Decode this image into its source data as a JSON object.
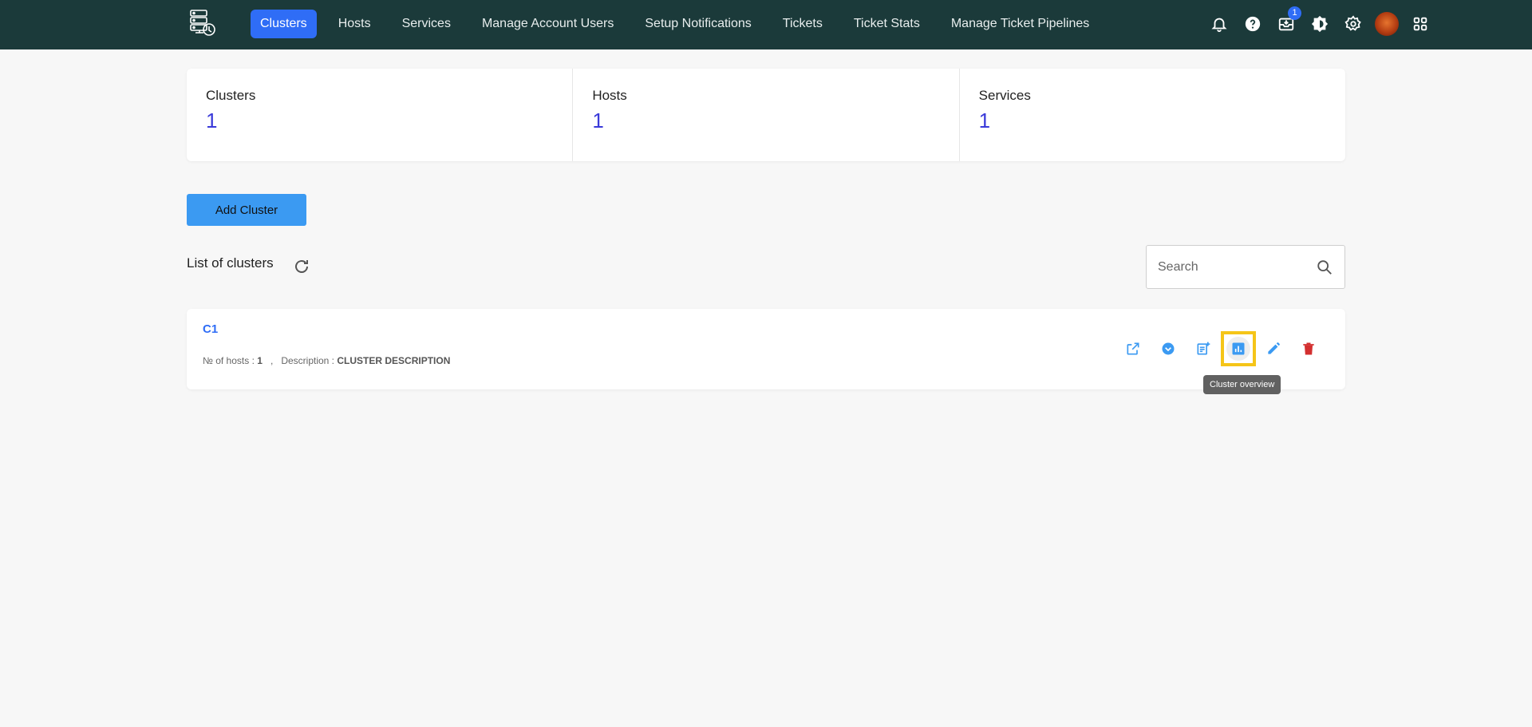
{
  "nav": {
    "items": [
      {
        "label": "Clusters",
        "active": true
      },
      {
        "label": "Hosts",
        "active": false
      },
      {
        "label": "Services",
        "active": false
      },
      {
        "label": "Manage Account Users",
        "active": false
      },
      {
        "label": "Setup Notifications",
        "active": false
      },
      {
        "label": "Tickets",
        "active": false
      },
      {
        "label": "Ticket Stats",
        "active": false
      },
      {
        "label": "Manage Ticket Pipelines",
        "active": false
      }
    ],
    "inbox_badge": "1",
    "icons": [
      "bell-icon",
      "help-icon",
      "inbox-icon",
      "brightness-icon",
      "gear-icon",
      "avatar",
      "apps-grid-icon"
    ]
  },
  "stats": [
    {
      "label": "Clusters",
      "value": "1"
    },
    {
      "label": "Hosts",
      "value": "1"
    },
    {
      "label": "Services",
      "value": "1"
    }
  ],
  "add_cluster_label": "Add Cluster",
  "list": {
    "title": "List of clusters",
    "search_placeholder": "Search"
  },
  "clusters": [
    {
      "name": "C1",
      "hosts_label": "№ of hosts :",
      "hosts_count": "1",
      "separator": ",",
      "description_label": "Description :",
      "description": "CLUSTER DESCRIPTION"
    }
  ],
  "tooltip": "Cluster overview",
  "colors": {
    "topbar": "#1b3a3a",
    "accent": "#2f6df6",
    "stat_value": "#3a3ad9",
    "action_blue": "#3b9af2",
    "delete_red": "#d32f2f",
    "highlight": "#f5c518"
  }
}
